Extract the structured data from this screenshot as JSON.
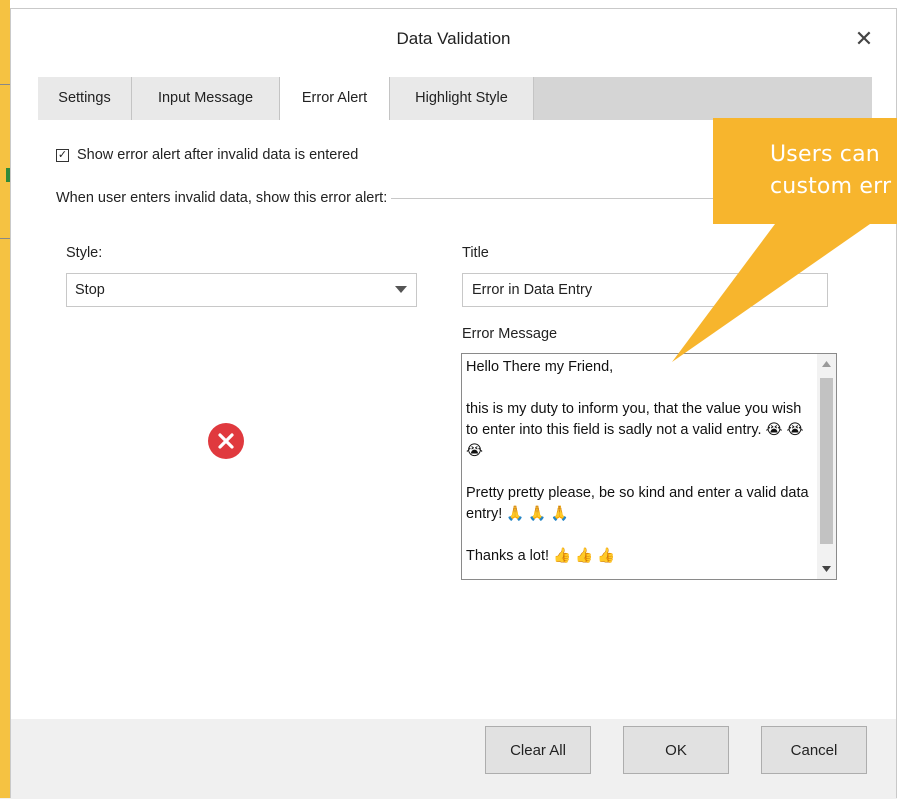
{
  "dialog": {
    "title": "Data Validation",
    "close_glyph": "✕"
  },
  "tabs": [
    {
      "label": "Settings",
      "active": false
    },
    {
      "label": "Input Message",
      "active": false
    },
    {
      "label": "Error Alert",
      "active": true
    },
    {
      "label": "Highlight Style",
      "active": false
    }
  ],
  "error_alert": {
    "show_alert_checked": true,
    "show_alert_label": "Show error alert after invalid data is entered",
    "section_label": "When user enters invalid data, show this error alert:",
    "style_label": "Style:",
    "style_value": "Stop",
    "title_label": "Title",
    "title_value": "Error in Data Entry",
    "message_label": "Error Message",
    "message_value": "Hello There my Friend,\n\nthis is my duty to inform you, that the value you wish to enter into this field is sadly not a valid entry. 😭 😭 😭\n\nPretty pretty please, be so kind and enter a valid data entry! 🙏 🙏 🙏\n\nThanks a lot! 👍 👍 👍",
    "style_icon": "error-stop-icon"
  },
  "footer": {
    "clear_all": "Clear All",
    "ok": "OK",
    "cancel": "Cancel"
  },
  "callout": {
    "line1": "Users can",
    "line2": "custom err"
  },
  "colors": {
    "accent_callout": "#f7b52d",
    "error_icon": "#e0393e",
    "tab_strip": "#d5d5d5"
  }
}
